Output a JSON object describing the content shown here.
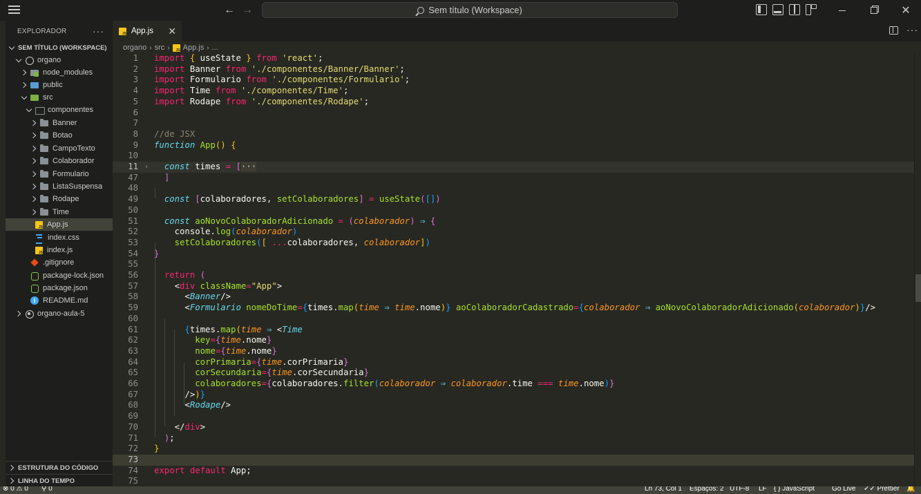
{
  "titlebar": {
    "search_text": "Sem título (Workspace)"
  },
  "sidebar": {
    "title": "EXPLORADOR",
    "more": "···",
    "workspace": "SEM TÍTULO (WORKSPACE)",
    "items": [
      {
        "label": "organo"
      },
      {
        "label": "node_modules"
      },
      {
        "label": "public"
      },
      {
        "label": "src"
      },
      {
        "label": "componentes"
      },
      {
        "label": "Banner"
      },
      {
        "label": "Botao"
      },
      {
        "label": "CampoTexto"
      },
      {
        "label": "Colaborador"
      },
      {
        "label": "Formulario"
      },
      {
        "label": "ListaSuspensa"
      },
      {
        "label": "Rodape"
      },
      {
        "label": "Time"
      },
      {
        "label": "App.js"
      },
      {
        "label": "index.css"
      },
      {
        "label": "index.js"
      },
      {
        "label": ".gitignore"
      },
      {
        "label": "package-lock.json"
      },
      {
        "label": "package.json"
      },
      {
        "label": "README.md"
      },
      {
        "label": "organo-aula-5"
      }
    ],
    "outline": "ESTRUTURA DO CÓDIGO",
    "timeline": "LINHA DO TEMPO"
  },
  "editor": {
    "tab_label": "App.js",
    "breadcrumb": [
      "organo",
      "src",
      "App.js",
      "..."
    ],
    "line_numbers": [
      "1",
      "2",
      "3",
      "4",
      "5",
      "6",
      "7",
      "8",
      "9",
      "10",
      "11",
      "47",
      "48",
      "49",
      "50",
      "51",
      "52",
      "53",
      "54",
      "55",
      "56",
      "57",
      "58",
      "59",
      "60",
      "61",
      "62",
      "63",
      "64",
      "65",
      "66",
      "67",
      "68",
      "69",
      "70",
      "71",
      "72",
      "73",
      "74",
      "75"
    ]
  },
  "statusbar": {
    "problems": "⊗ 0 ⚠ 0",
    "ports": "⚲ 0",
    "position": "Ln 73, Col 1",
    "spaces": "Espaços: 2",
    "encoding": "UTF-8",
    "eol": "LF",
    "language": "{ } JavaScript",
    "golive": "Go Live",
    "prettier": "✓✓ Prettier",
    "bell": "🔔"
  },
  "colors": {
    "background": "#272822",
    "sidebar": "#1e1f1c",
    "keyword": "#f92672",
    "string": "#e6db74",
    "function": "#a6e22e",
    "type": "#66d9ef",
    "parameter": "#fd971f"
  }
}
